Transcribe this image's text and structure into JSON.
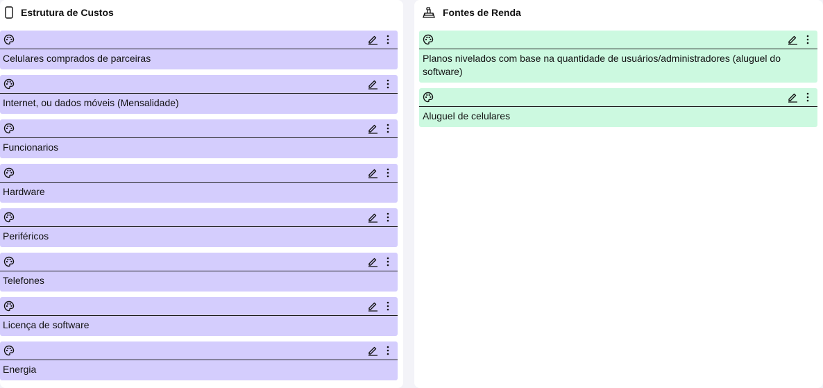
{
  "left_panel": {
    "title": "Estrutura de Custos",
    "icon": "phone-icon",
    "color": "#d4cdfd",
    "cards": [
      {
        "text": "Celulares comprados de parceiras"
      },
      {
        "text": "Internet, ou dados móveis (Mensalidade)"
      },
      {
        "text": "Funcionarios"
      },
      {
        "text": "Hardware"
      },
      {
        "text": "Periféricos"
      },
      {
        "text": "Telefones"
      },
      {
        "text": "Licença de software"
      },
      {
        "text": "Energia"
      }
    ]
  },
  "right_panel": {
    "title": "Fontes de Renda",
    "icon": "cash-register-icon",
    "color": "#ccf9e0",
    "cards": [
      {
        "text": "Planos nivelados com base na quantidade de usuários/administradores (aluguel do software)"
      },
      {
        "text": "Aluguel de celulares"
      }
    ]
  },
  "card_icons": [
    "palette-icon",
    "pencil-icon",
    "more-vertical-icon"
  ]
}
